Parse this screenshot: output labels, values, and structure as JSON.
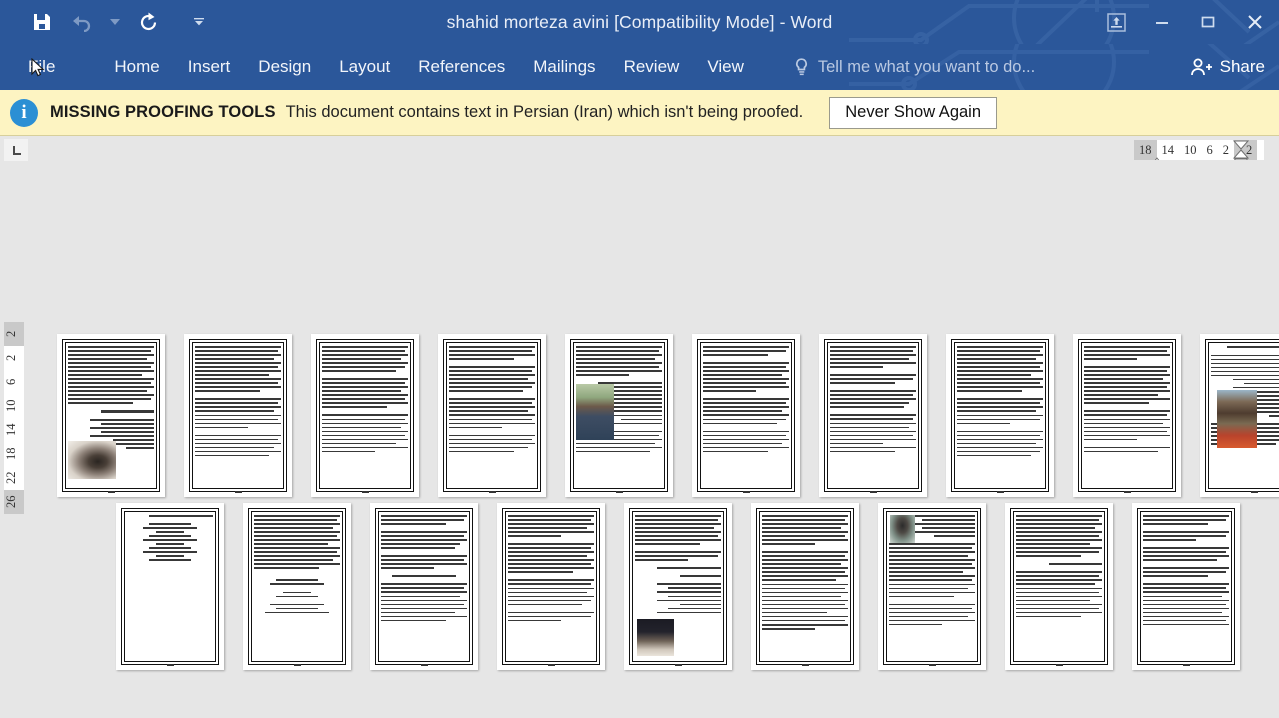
{
  "window": {
    "title": "shahid morteza avini [Compatibility Mode] - Word",
    "theme_color": "#2b579a",
    "controls": [
      {
        "name": "ribbon-display-options",
        "glyph": "ribbon"
      },
      {
        "name": "minimize",
        "glyph": "minimize"
      },
      {
        "name": "restore",
        "glyph": "restore"
      },
      {
        "name": "close",
        "glyph": "close"
      }
    ]
  },
  "quick_access": {
    "items": [
      {
        "name": "save",
        "label": "Save",
        "icon": "save-icon",
        "enabled": true
      },
      {
        "name": "undo",
        "label": "Undo",
        "icon": "undo-icon",
        "enabled": false
      },
      {
        "name": "undo-dropdown",
        "label": "Undo options",
        "icon": "chevron-down-icon",
        "enabled": false
      },
      {
        "name": "repeat",
        "label": "Repeat",
        "icon": "repeat-icon",
        "enabled": true
      },
      {
        "name": "customize",
        "label": "Customize Quick Access Toolbar",
        "icon": "chevron-down-icon",
        "enabled": true
      }
    ]
  },
  "ribbon": {
    "tabs": [
      {
        "label": "File",
        "active": false
      },
      {
        "label": "Home",
        "active": false
      },
      {
        "label": "Insert",
        "active": false
      },
      {
        "label": "Design",
        "active": false
      },
      {
        "label": "Layout",
        "active": false
      },
      {
        "label": "References",
        "active": false
      },
      {
        "label": "Mailings",
        "active": false
      },
      {
        "label": "Review",
        "active": false
      },
      {
        "label": "View",
        "active": false
      }
    ],
    "tell_me": "Tell me what you want to do...",
    "share_label": "Share"
  },
  "message_bar": {
    "icon": "info-icon",
    "headline": "MISSING PROOFING TOOLS",
    "text": "This document contains text in Persian (Iran) which isn't being proofed.",
    "button": "Never Show Again",
    "background": "#fdf4c2"
  },
  "rulers": {
    "tab_stop_marker": "L",
    "horizontal_ticks": [
      "18",
      "14",
      "10",
      "6",
      "2",
      "2"
    ],
    "vertical_ticks": [
      "2",
      "2",
      "6",
      "10",
      "14",
      "18",
      "22",
      "26"
    ]
  },
  "document": {
    "view": "Multiple Pages",
    "rows": [
      {
        "name": "thumbnail-row-1",
        "pages": [
          {
            "n": 1,
            "layout": "text-photo-left",
            "photo": "bw-portrait-bearded-man"
          },
          {
            "n": 2,
            "layout": "text-only",
            "photo": null
          },
          {
            "n": 3,
            "layout": "text-only",
            "photo": null
          },
          {
            "n": 4,
            "layout": "text-only",
            "photo": null
          },
          {
            "n": 5,
            "layout": "text-photo-left",
            "photo": "color-portrait-blue-shirt"
          },
          {
            "n": 6,
            "layout": "text-only",
            "photo": null
          },
          {
            "n": 7,
            "layout": "text-only",
            "photo": null
          },
          {
            "n": 8,
            "layout": "text-only",
            "photo": null
          },
          {
            "n": 9,
            "layout": "text-only",
            "photo": null
          },
          {
            "n": 10,
            "layout": "text-photo-center",
            "photo": "color-portrait-with-flowers"
          }
        ]
      },
      {
        "name": "thumbnail-row-2",
        "pages": [
          {
            "n": 11,
            "layout": "poem-centered",
            "photo": null
          },
          {
            "n": 12,
            "layout": "text-poem",
            "photo": null
          },
          {
            "n": 13,
            "layout": "text-only",
            "photo": null
          },
          {
            "n": 14,
            "layout": "text-only",
            "photo": null
          },
          {
            "n": 15,
            "layout": "text-photo-left",
            "photo": "bw-photo-cleric-turban"
          },
          {
            "n": 16,
            "layout": "text-only",
            "photo": null
          },
          {
            "n": 17,
            "layout": "text-photo-topleft",
            "photo": "small-portrait-bearded-man"
          },
          {
            "n": 18,
            "layout": "text-only",
            "photo": null
          },
          {
            "n": 19,
            "layout": "text-only",
            "photo": null
          }
        ]
      }
    ]
  },
  "cursor": {
    "name": "mouse-pointer",
    "over": "File"
  }
}
